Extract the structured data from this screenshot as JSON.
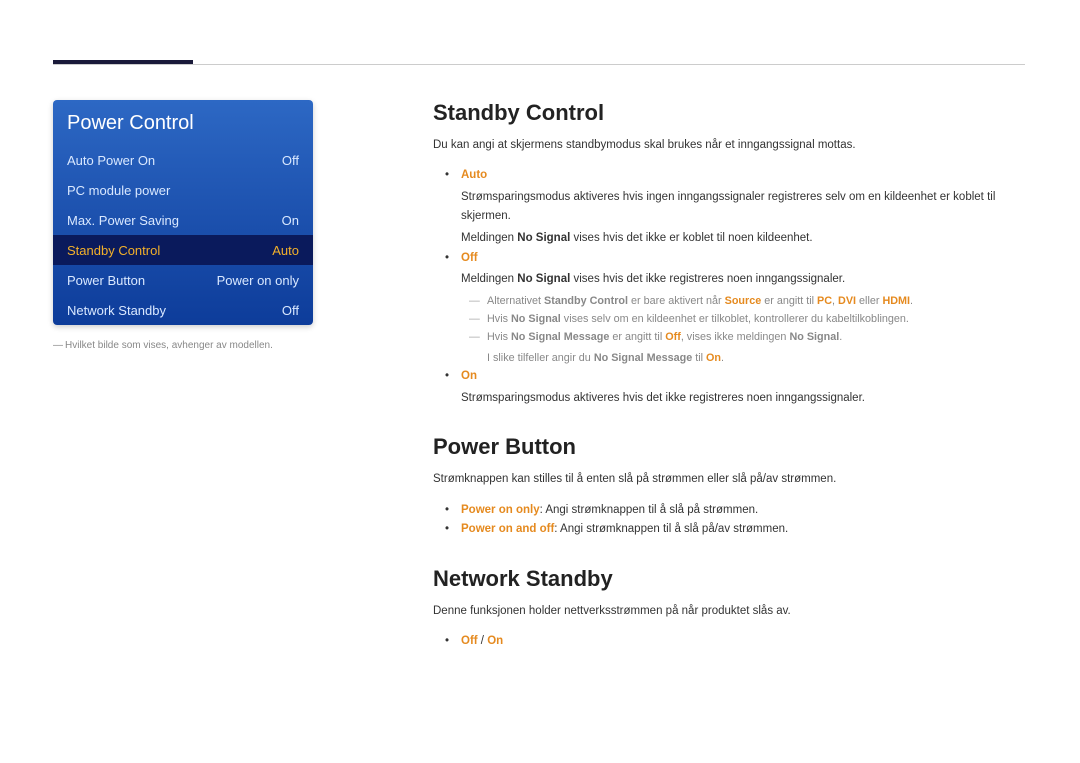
{
  "menu": {
    "title": "Power Control",
    "items": [
      {
        "label": "Auto Power On",
        "value": "Off"
      },
      {
        "label": "PC module power",
        "value": ""
      },
      {
        "label": "Max. Power Saving",
        "value": "On"
      },
      {
        "label": "Standby Control",
        "value": "Auto"
      },
      {
        "label": "Power Button",
        "value": "Power on only"
      },
      {
        "label": "Network Standby",
        "value": "Off"
      }
    ],
    "footnote": "Hvilket bilde som vises, avhenger av modellen."
  },
  "content": {
    "standby": {
      "heading": "Standby Control",
      "intro": "Du kan angi at skjermens standbymodus skal brukes når et inngangssignal mottas.",
      "auto": {
        "label": "Auto",
        "l1": "Strømsparingsmodus aktiveres hvis ingen inngangssignaler registreres selv om en kildeenhet er koblet til skjermen.",
        "l2a": "Meldingen ",
        "l2b": "No Signal",
        "l2c": " vises hvis det ikke er koblet til noen kildeenhet."
      },
      "off": {
        "label": "Off",
        "l1a": "Meldingen ",
        "l1b": "No Signal",
        "l1c": " vises hvis det ikke registreres noen inngangssignaler.",
        "sub1": {
          "a": "Alternativet ",
          "b": "Standby Control",
          "c": " er bare aktivert når ",
          "d": "Source",
          "e": " er angitt til ",
          "f": "PC",
          "g": ", ",
          "h": "DVI",
          "i": " eller ",
          "j": "HDMI",
          "k": "."
        },
        "sub2": {
          "a": "Hvis ",
          "b": "No Signal",
          "c": " vises selv om en kildeenhet er tilkoblet, kontrollerer du kabeltilkoblingen."
        },
        "sub3": {
          "a": "Hvis ",
          "b": "No Signal Message",
          "c": " er angitt til ",
          "d": "Off",
          "e": ", vises ikke meldingen ",
          "f": "No Signal",
          "g": ".",
          "h": "I slike tilfeller angir du ",
          "i": "No Signal Message",
          "j": " til ",
          "k": "On",
          "l": "."
        }
      },
      "on": {
        "label": "On",
        "l1": "Strømsparingsmodus aktiveres hvis det ikke registreres noen inngangssignaler."
      }
    },
    "powerbutton": {
      "heading": "Power Button",
      "intro": "Strømknappen kan stilles til å enten slå på strømmen eller slå på/av strømmen.",
      "l1": {
        "a": "Power on only",
        "b": ": Angi strømknappen til å slå på strømmen."
      },
      "l2": {
        "a": "Power on and off",
        "b": ": Angi strømknappen til å slå på/av strømmen."
      }
    },
    "network": {
      "heading": "Network Standby",
      "intro": "Denne funksjonen holder nettverksstrømmen på når produktet slås av.",
      "l1": {
        "a": "Off",
        "b": " / ",
        "c": "On"
      }
    }
  }
}
